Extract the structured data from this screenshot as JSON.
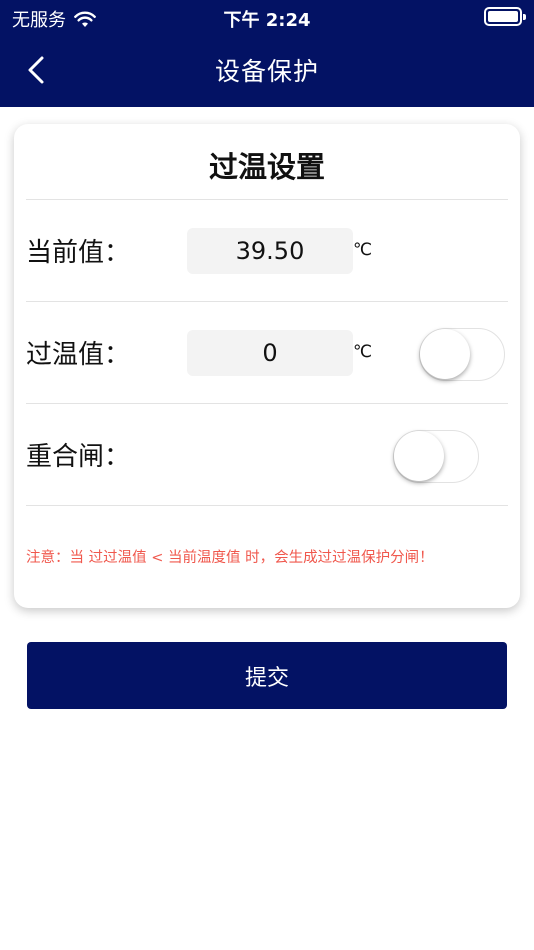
{
  "status_bar": {
    "carrier": "无服务",
    "time": "下午 2:24"
  },
  "nav": {
    "title": "设备保护",
    "back_icon": "chevron-left-icon"
  },
  "card": {
    "title": "过温设置",
    "current": {
      "label": "当前值：",
      "value": "39.50",
      "unit": "℃"
    },
    "over_temp": {
      "label": "过温值：",
      "value": "0",
      "unit": "℃",
      "enabled": false
    },
    "reclose": {
      "label": "重合闸：",
      "enabled": false
    },
    "note": "注意：当 过过温值 < 当前温度值 时，会生成过过温保护分闸！"
  },
  "submit_label": "提交",
  "colors": {
    "primary": "#031264",
    "note": "#f0584d",
    "field_bg": "#f3f3f3"
  }
}
